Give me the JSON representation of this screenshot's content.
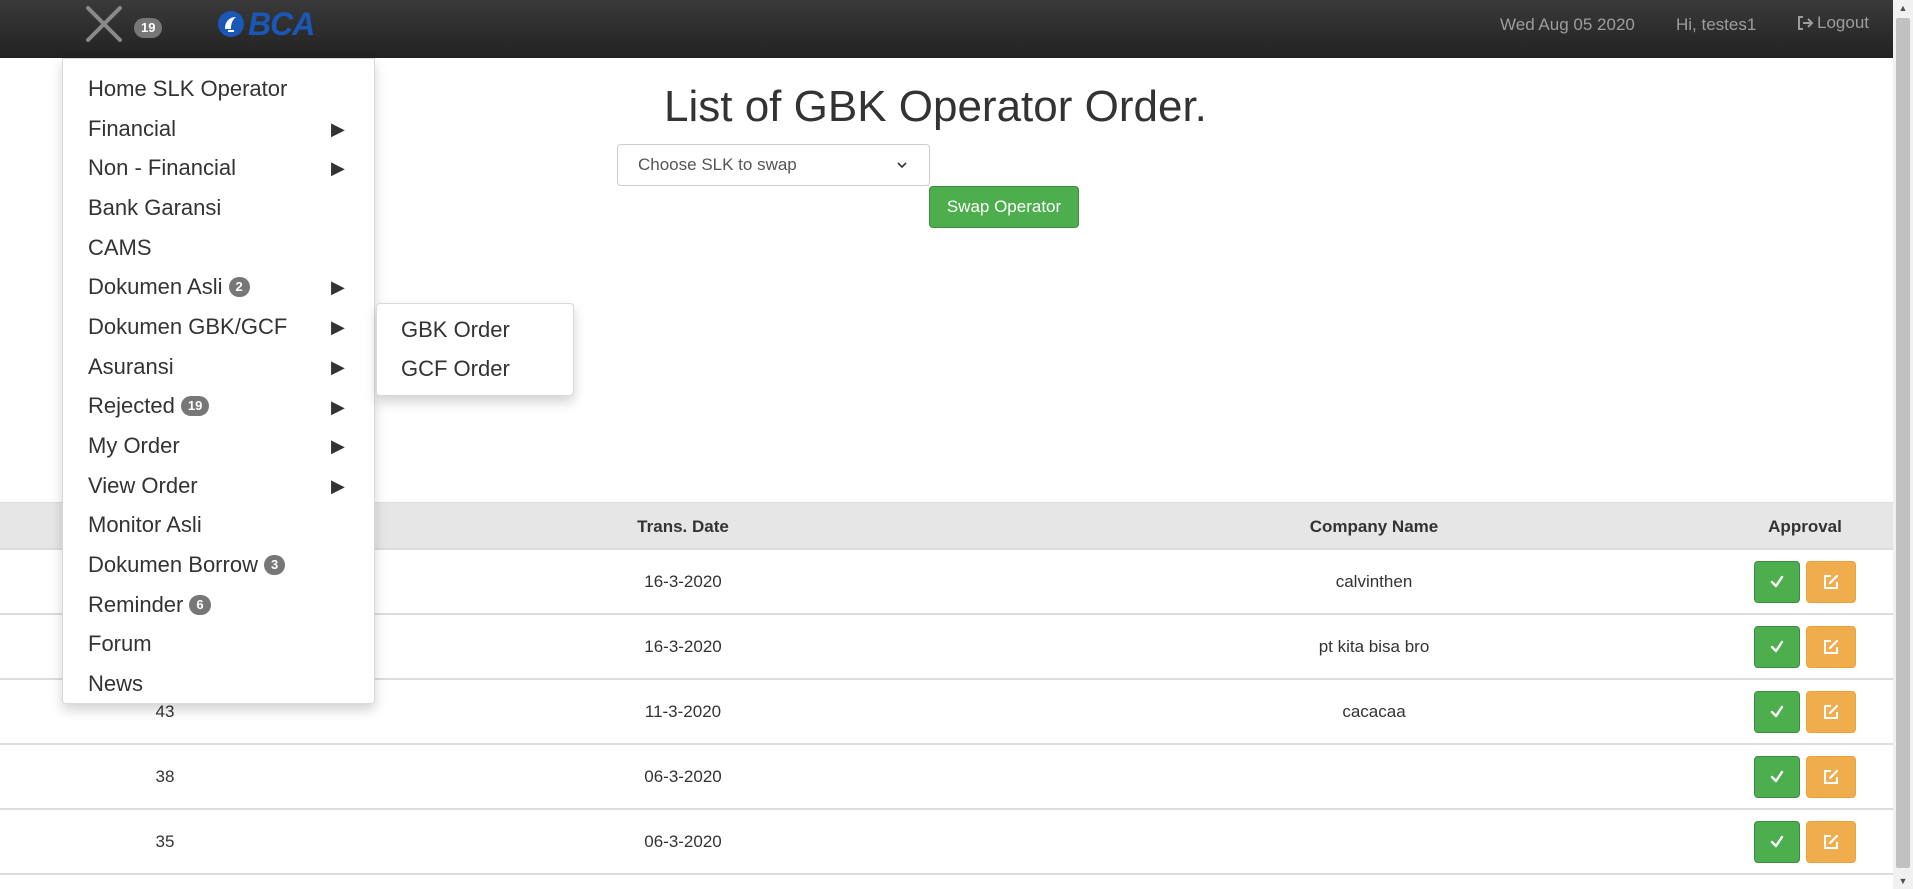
{
  "navbar": {
    "notification_count": "19",
    "brand": "BCA",
    "date": "Wed Aug 05 2020",
    "greeting": "Hi, testes1",
    "logout_label": "Logout"
  },
  "main": {
    "title": "List of GBK Operator Order.",
    "select_value": "Choose SLK to swap",
    "swap_button": "Swap Operator"
  },
  "table": {
    "headers": {
      "trans_date": "Trans. Date",
      "company_name": "Company Name",
      "approval": "Approval"
    },
    "rows": [
      {
        "id": "",
        "date": "16-3-2020",
        "company": "calvinthen"
      },
      {
        "id": "",
        "date": "16-3-2020",
        "company": "pt kita bisa bro"
      },
      {
        "id": "43",
        "date": "11-3-2020",
        "company": "cacacaa"
      },
      {
        "id": "38",
        "date": "06-3-2020",
        "company": ""
      },
      {
        "id": "35",
        "date": "06-3-2020",
        "company": ""
      }
    ]
  },
  "menu": {
    "items": [
      {
        "label": "Home SLK Operator",
        "badge": "",
        "has_submenu": false
      },
      {
        "label": "Financial",
        "badge": "",
        "has_submenu": true
      },
      {
        "label": "Non - Financial",
        "badge": "",
        "has_submenu": true
      },
      {
        "label": "Bank Garansi",
        "badge": "",
        "has_submenu": false
      },
      {
        "label": "CAMS",
        "badge": "",
        "has_submenu": false
      },
      {
        "label": "Dokumen Asli",
        "badge": "2",
        "has_submenu": true
      },
      {
        "label": "Dokumen GBK/GCF",
        "badge": "",
        "has_submenu": true
      },
      {
        "label": "Asuransi",
        "badge": "",
        "has_submenu": true
      },
      {
        "label": "Rejected",
        "badge": "19",
        "has_submenu": true
      },
      {
        "label": "My Order",
        "badge": "",
        "has_submenu": true
      },
      {
        "label": "View Order",
        "badge": "",
        "has_submenu": true
      },
      {
        "label": "Monitor Asli",
        "badge": "",
        "has_submenu": false
      },
      {
        "label": "Dokumen Borrow",
        "badge": "3",
        "has_submenu": false
      },
      {
        "label": "Reminder",
        "badge": "6",
        "has_submenu": false
      },
      {
        "label": "Forum",
        "badge": "",
        "has_submenu": false
      },
      {
        "label": "News",
        "badge": "",
        "has_submenu": false
      }
    ],
    "arrow_glyph": "▶"
  },
  "submenu": {
    "items": [
      "GBK Order",
      "GCF Order"
    ]
  },
  "colors": {
    "navbar": "#222222",
    "success": "#4cae4c",
    "warning": "#f0ad4e",
    "brand_blue": "#1a57b6",
    "badge": "#777777"
  },
  "icons": {
    "menu_toggle": "close-icon",
    "logout": "logout-icon",
    "approve": "check-icon",
    "edit": "edit-icon",
    "select": "chevron-down-icon"
  }
}
